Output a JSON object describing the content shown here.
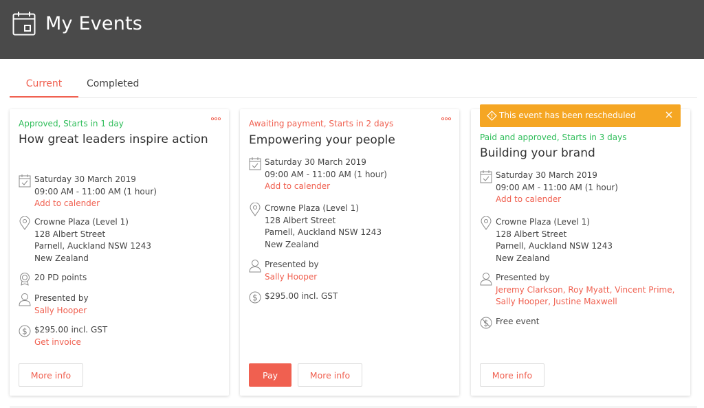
{
  "header": {
    "title": "My Events"
  },
  "tabs": [
    {
      "label": "Current"
    },
    {
      "label": "Completed"
    }
  ],
  "alert": {
    "text": "This event has been rescheduled"
  },
  "cards": [
    {
      "status": "Approved, Starts in 1 day",
      "title": "How great leaders inspire action",
      "date": "Saturday 30 March 2019",
      "time": "09:00 AM - 11:00 AM (1 hour)",
      "add_calendar": "Add to calender",
      "location": [
        "Crowne Plaza (Level 1)",
        "128 Albert Street",
        "Parnell, Auckland NSW 1243",
        "New Zealand"
      ],
      "points": "20 PD points",
      "presented_label": "Presented by",
      "presenters": "Sally Hooper",
      "price": "$295.00 incl. GST",
      "invoice": "Get invoice",
      "more_info": "More info"
    },
    {
      "status": "Awaiting payment, Starts in 2 days",
      "title": "Empowering your people",
      "date": "Saturday 30 March 2019",
      "time": "09:00 AM - 11:00 AM (1 hour)",
      "add_calendar": "Add to calender",
      "location": [
        "Crowne Plaza (Level 1)",
        "128 Albert Street",
        "Parnell, Auckland NSW 1243",
        "New Zealand"
      ],
      "presented_label": "Presented by",
      "presenters": "Sally Hooper",
      "price": "$295.00 incl. GST",
      "pay": "Pay",
      "more_info": "More info"
    },
    {
      "status": "Paid and approved, Starts in 3 days",
      "title": "Building your brand",
      "date": "Saturday 30 March 2019",
      "time": "09:00 AM - 11:00 AM (1 hour)",
      "add_calendar": "Add to calender",
      "location": [
        "Crowne Plaza (Level 1)",
        "128 Albert Street",
        "Parnell, Auckland NSW 1243",
        "New Zealand"
      ],
      "presented_label": "Presented by",
      "presenters": "Jeremy Clarkson, Roy Myatt, Vincent Prime, Sally Hooper, Justine Maxwell",
      "price": "Free event",
      "more_info": "More info"
    }
  ],
  "icons": {
    "header": "calendar-icon",
    "date": "calendar-check-icon",
    "location": "map-pin-icon",
    "points": "award-icon",
    "presenter": "person-icon",
    "price": "dollar-icon",
    "free": "no-dollar-icon",
    "alert": "warning-icon",
    "close": "close-icon",
    "more": "more-dots-icon"
  },
  "colors": {
    "header_bg": "#4a4a4a",
    "accent": "#f06050",
    "approved": "#2ebd59",
    "alert_bg": "#f5a623"
  }
}
